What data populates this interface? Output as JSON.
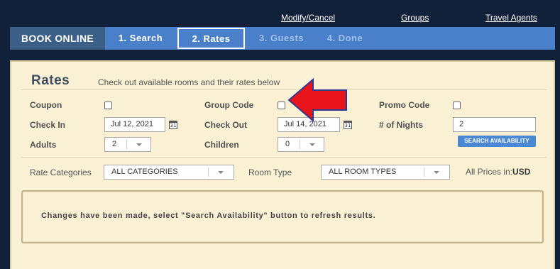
{
  "toplinks": {
    "modify": "Modify/Cancel",
    "groups": "Groups",
    "agents": "Travel Agents"
  },
  "nav": {
    "book": "BOOK ONLINE",
    "steps": [
      "1. Search",
      "2. Rates",
      "3. Guests",
      "4. Done"
    ],
    "active_step": "2. Rates"
  },
  "rates": {
    "title": "Rates",
    "subtitle": "Check out available rooms and their rates below"
  },
  "form": {
    "coupon_label": "Coupon",
    "group_code_label": "Group Code",
    "promo_code_label": "Promo Code",
    "check_in_label": "Check In",
    "check_in_value": "Jul 12, 2021",
    "check_out_label": "Check Out",
    "check_out_value": "Jul 14, 2021",
    "nights_label": "# of Nights",
    "nights_value": "2",
    "adults_label": "Adults",
    "adults_value": "2",
    "children_label": "Children",
    "children_value": "0",
    "calendar_day": "31",
    "search_button": "SEARCH AVAILABILITY"
  },
  "filters": {
    "rate_categories_label": "Rate Categories",
    "rate_categories_value": "ALL CATEGORIES",
    "room_type_label": "Room Type",
    "room_type_value": "ALL ROOM TYPES",
    "prices_label": "All Prices in:",
    "currency": "USD"
  },
  "message": "Changes have been made, select \"Search Availability\" button to refresh results.",
  "colors": {
    "page_bg": "#12213a",
    "nav_bg": "#4a80c9",
    "book_bg": "#3c5f88",
    "panel_bg": "#faf1d4",
    "arrow": "#e8141b",
    "button": "#4a88d4"
  }
}
